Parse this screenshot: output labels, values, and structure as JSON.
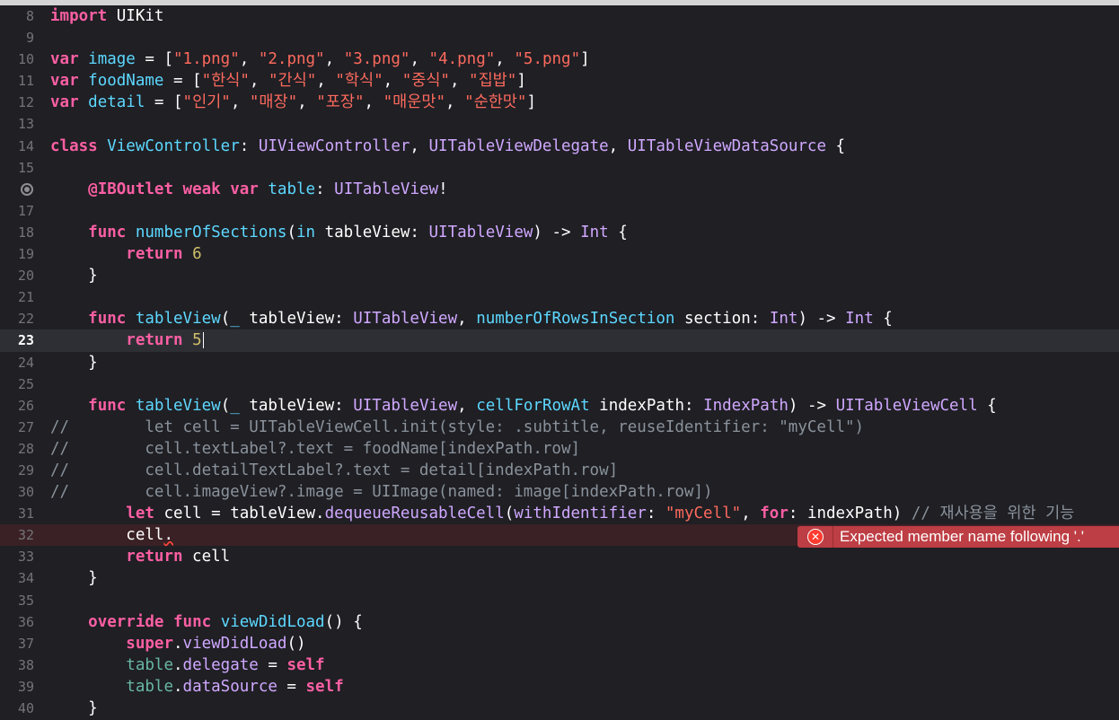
{
  "lines": [
    {
      "n": "8",
      "tokens": [
        {
          "c": "kw",
          "t": "import"
        },
        {
          "t": " UIKit"
        }
      ]
    },
    {
      "n": "9",
      "tokens": []
    },
    {
      "n": "10",
      "tokens": [
        {
          "c": "kw",
          "t": "var"
        },
        {
          "t": " "
        },
        {
          "c": "cls",
          "t": "image"
        },
        {
          "t": " = ["
        },
        {
          "c": "str",
          "t": "\"1.png\""
        },
        {
          "t": ", "
        },
        {
          "c": "str",
          "t": "\"2.png\""
        },
        {
          "t": ", "
        },
        {
          "c": "str",
          "t": "\"3.png\""
        },
        {
          "t": ", "
        },
        {
          "c": "str",
          "t": "\"4.png\""
        },
        {
          "t": ", "
        },
        {
          "c": "str",
          "t": "\"5.png\""
        },
        {
          "t": "]"
        }
      ]
    },
    {
      "n": "11",
      "tokens": [
        {
          "c": "kw",
          "t": "var"
        },
        {
          "t": " "
        },
        {
          "c": "cls",
          "t": "foodName"
        },
        {
          "t": " = ["
        },
        {
          "c": "str",
          "t": "\"한식\""
        },
        {
          "t": ", "
        },
        {
          "c": "str",
          "t": "\"간식\""
        },
        {
          "t": ", "
        },
        {
          "c": "str",
          "t": "\"학식\""
        },
        {
          "t": ", "
        },
        {
          "c": "str",
          "t": "\"중식\""
        },
        {
          "t": ", "
        },
        {
          "c": "str",
          "t": "\"집밥\""
        },
        {
          "t": "]"
        }
      ]
    },
    {
      "n": "12",
      "tokens": [
        {
          "c": "kw",
          "t": "var"
        },
        {
          "t": " "
        },
        {
          "c": "cls",
          "t": "detail"
        },
        {
          "t": " = ["
        },
        {
          "c": "str",
          "t": "\"인기\""
        },
        {
          "t": ", "
        },
        {
          "c": "str",
          "t": "\"매장\""
        },
        {
          "t": ", "
        },
        {
          "c": "str",
          "t": "\"포장\""
        },
        {
          "t": ", "
        },
        {
          "c": "str",
          "t": "\"매운맛\""
        },
        {
          "t": ", "
        },
        {
          "c": "str",
          "t": "\"순한맛\""
        },
        {
          "t": "]"
        }
      ]
    },
    {
      "n": "13",
      "tokens": []
    },
    {
      "n": "14",
      "tokens": [
        {
          "c": "kw",
          "t": "class"
        },
        {
          "t": " "
        },
        {
          "c": "cls",
          "t": "ViewController"
        },
        {
          "t": ": "
        },
        {
          "c": "type",
          "t": "UIViewController"
        },
        {
          "t": ", "
        },
        {
          "c": "type",
          "t": "UITableViewDelegate"
        },
        {
          "t": ", "
        },
        {
          "c": "type",
          "t": "UITableViewDataSource"
        },
        {
          "t": " {"
        }
      ]
    },
    {
      "n": "15",
      "tokens": []
    },
    {
      "n": "",
      "bp": true,
      "tokens": [
        {
          "t": "    "
        },
        {
          "c": "kw",
          "t": "@IBOutlet"
        },
        {
          "t": " "
        },
        {
          "c": "kw",
          "t": "weak"
        },
        {
          "t": " "
        },
        {
          "c": "kw",
          "t": "var"
        },
        {
          "t": " "
        },
        {
          "c": "cls",
          "t": "table"
        },
        {
          "t": ": "
        },
        {
          "c": "type",
          "t": "UITableView"
        },
        {
          "t": "!"
        }
      ]
    },
    {
      "n": "17",
      "tokens": []
    },
    {
      "n": "18",
      "tokens": [
        {
          "t": "    "
        },
        {
          "c": "kw",
          "t": "func"
        },
        {
          "t": " "
        },
        {
          "c": "cls",
          "t": "numberOfSections"
        },
        {
          "t": "("
        },
        {
          "c": "cls",
          "t": "in"
        },
        {
          "t": " tableView: "
        },
        {
          "c": "type",
          "t": "UITableView"
        },
        {
          "t": ") -> "
        },
        {
          "c": "type",
          "t": "Int"
        },
        {
          "t": " {"
        }
      ]
    },
    {
      "n": "19",
      "tokens": [
        {
          "t": "        "
        },
        {
          "c": "kw",
          "t": "return"
        },
        {
          "t": " "
        },
        {
          "c": "num",
          "t": "6"
        }
      ]
    },
    {
      "n": "20",
      "tokens": [
        {
          "t": "    }"
        }
      ]
    },
    {
      "n": "21",
      "tokens": []
    },
    {
      "n": "22",
      "tokens": [
        {
          "t": "    "
        },
        {
          "c": "kw",
          "t": "func"
        },
        {
          "t": " "
        },
        {
          "c": "cls",
          "t": "tableView"
        },
        {
          "t": "("
        },
        {
          "c": "cls",
          "t": "_"
        },
        {
          "t": " tableView: "
        },
        {
          "c": "type",
          "t": "UITableView"
        },
        {
          "t": ", "
        },
        {
          "c": "cls",
          "t": "numberOfRowsInSection"
        },
        {
          "t": " section: "
        },
        {
          "c": "type",
          "t": "Int"
        },
        {
          "t": ") -> "
        },
        {
          "c": "type",
          "t": "Int"
        },
        {
          "t": " {"
        }
      ]
    },
    {
      "n": "23",
      "current": true,
      "caret": true,
      "tokens": [
        {
          "t": "        "
        },
        {
          "c": "kw",
          "t": "return"
        },
        {
          "t": " "
        },
        {
          "c": "num",
          "t": "5"
        }
      ]
    },
    {
      "n": "24",
      "tokens": [
        {
          "t": "    }"
        }
      ]
    },
    {
      "n": "25",
      "tokens": []
    },
    {
      "n": "26",
      "tokens": [
        {
          "t": "    "
        },
        {
          "c": "kw",
          "t": "func"
        },
        {
          "t": " "
        },
        {
          "c": "cls",
          "t": "tableView"
        },
        {
          "t": "("
        },
        {
          "c": "cls",
          "t": "_"
        },
        {
          "t": " tableView: "
        },
        {
          "c": "type",
          "t": "UITableView"
        },
        {
          "t": ", "
        },
        {
          "c": "cls",
          "t": "cellForRowAt"
        },
        {
          "t": " indexPath: "
        },
        {
          "c": "type",
          "t": "IndexPath"
        },
        {
          "t": ") -> "
        },
        {
          "c": "type",
          "t": "UITableViewCell"
        },
        {
          "t": " {"
        }
      ]
    },
    {
      "n": "27",
      "tokens": [
        {
          "c": "cmt",
          "t": "//        let cell = UITableViewCell.init(style: .subtitle, reuseIdentifier: \"myCell\")"
        }
      ]
    },
    {
      "n": "28",
      "tokens": [
        {
          "c": "cmt",
          "t": "//        cell.textLabel?.text = foodName[indexPath.row]"
        }
      ]
    },
    {
      "n": "29",
      "tokens": [
        {
          "c": "cmt",
          "t": "//        cell.detailTextLabel?.text = detail[indexPath.row]"
        }
      ]
    },
    {
      "n": "30",
      "tokens": [
        {
          "c": "cmt",
          "t": "//        cell.imageView?.image = UIImage(named: image[indexPath.row])"
        }
      ]
    },
    {
      "n": "31",
      "tokens": [
        {
          "t": "        "
        },
        {
          "c": "kw",
          "t": "let"
        },
        {
          "t": " cell = tableView."
        },
        {
          "c": "type",
          "t": "dequeueReusableCell"
        },
        {
          "t": "("
        },
        {
          "c": "type",
          "t": "withIdentifier"
        },
        {
          "t": ": "
        },
        {
          "c": "str",
          "t": "\"myCell\""
        },
        {
          "t": ", "
        },
        {
          "c": "kw",
          "t": "for"
        },
        {
          "t": ": indexPath) "
        },
        {
          "c": "cmt",
          "t": "// 재사용을 위한 기능"
        }
      ]
    },
    {
      "n": "32",
      "error": true,
      "tokens": [
        {
          "t": "        cell"
        },
        {
          "c": "squiggle",
          "t": "."
        }
      ]
    },
    {
      "n": "33",
      "tokens": [
        {
          "t": "        "
        },
        {
          "c": "kw",
          "t": "return"
        },
        {
          "t": " cell"
        }
      ]
    },
    {
      "n": "34",
      "tokens": [
        {
          "t": "    }"
        }
      ]
    },
    {
      "n": "35",
      "tokens": []
    },
    {
      "n": "36",
      "tokens": [
        {
          "t": "    "
        },
        {
          "c": "kw",
          "t": "override"
        },
        {
          "t": " "
        },
        {
          "c": "kw",
          "t": "func"
        },
        {
          "t": " "
        },
        {
          "c": "cls",
          "t": "viewDidLoad"
        },
        {
          "t": "() {"
        }
      ]
    },
    {
      "n": "37",
      "tokens": [
        {
          "t": "        "
        },
        {
          "c": "kw",
          "t": "super"
        },
        {
          "t": "."
        },
        {
          "c": "type",
          "t": "viewDidLoad"
        },
        {
          "t": "()"
        }
      ]
    },
    {
      "n": "38",
      "tokens": [
        {
          "t": "        "
        },
        {
          "c": "fn",
          "t": "table"
        },
        {
          "t": "."
        },
        {
          "c": "type",
          "t": "delegate"
        },
        {
          "t": " = "
        },
        {
          "c": "kw",
          "t": "self"
        }
      ]
    },
    {
      "n": "39",
      "tokens": [
        {
          "t": "        "
        },
        {
          "c": "fn",
          "t": "table"
        },
        {
          "t": "."
        },
        {
          "c": "type",
          "t": "dataSource"
        },
        {
          "t": " = "
        },
        {
          "c": "kw",
          "t": "self"
        }
      ]
    },
    {
      "n": "40",
      "tokens": [
        {
          "t": "    }"
        }
      ]
    }
  ],
  "error_banner": {
    "icon": "error-x-icon",
    "message": "Expected member name following '.'"
  },
  "colors": {
    "background": "#1f1f24",
    "keyword": "#fc5fa3",
    "string": "#fc6a5d",
    "number": "#d0bf69",
    "type": "#d0a8ff",
    "declaration": "#5dd8ff",
    "comment": "#8a929b",
    "error": "#bd3e44"
  }
}
